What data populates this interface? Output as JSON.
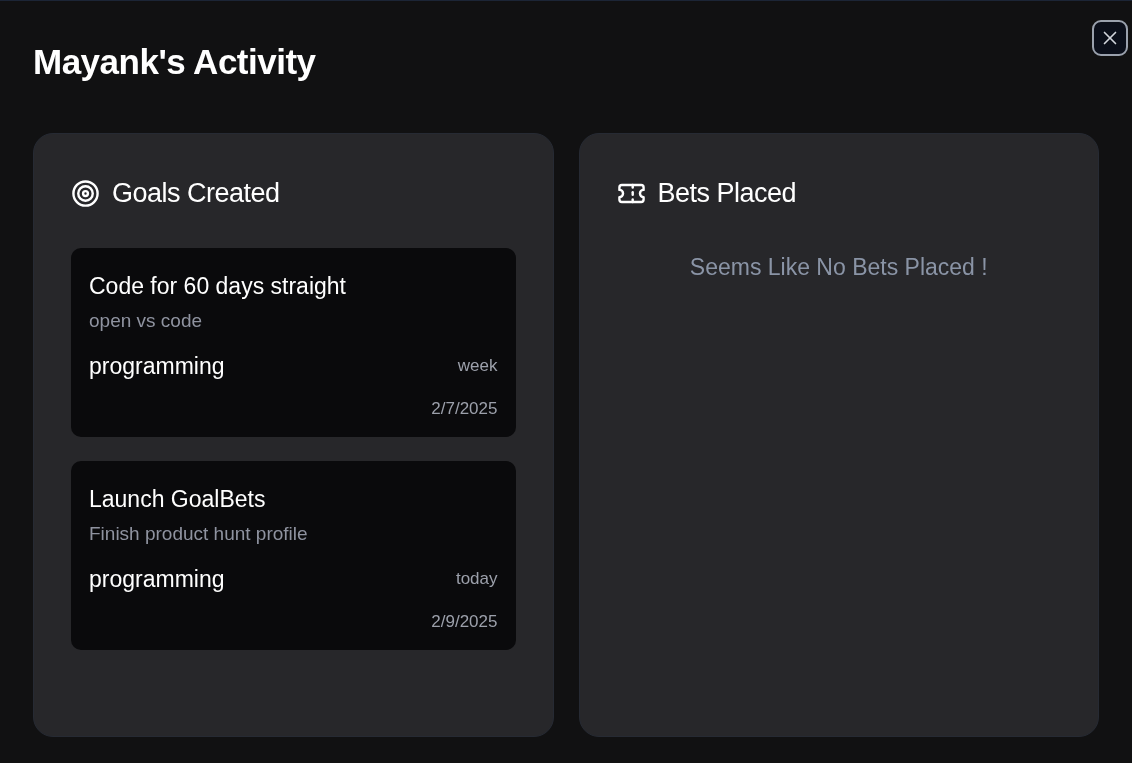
{
  "dialog": {
    "title": "Mayank's Activity"
  },
  "goals_panel": {
    "title": "Goals Created",
    "goals": [
      {
        "title": "Code for 60 days straight",
        "description": "open vs code",
        "category": "programming",
        "frequency": "week",
        "date": "2/7/2025"
      },
      {
        "title": "Launch GoalBets",
        "description": "Finish product hunt profile",
        "category": "programming",
        "frequency": "today",
        "date": "2/9/2025"
      }
    ]
  },
  "bets_panel": {
    "title": "Bets Placed",
    "empty_message": "Seems Like No Bets Placed !"
  }
}
